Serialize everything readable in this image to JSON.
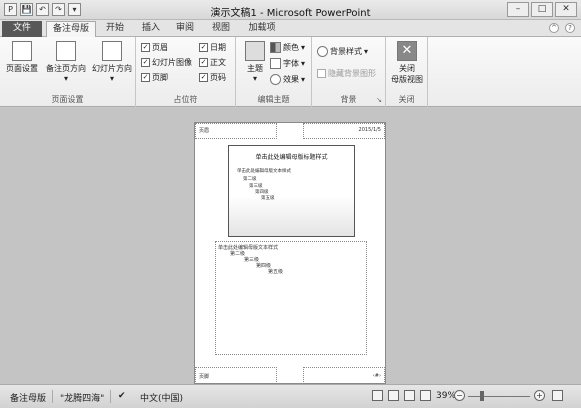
{
  "window": {
    "title": "演示文稿1 - Microsoft PowerPoint",
    "controls": [
      "–",
      "□",
      "✕"
    ]
  },
  "qat": [
    "P",
    "💾",
    "↶",
    "↷",
    "▾"
  ],
  "tabs": [
    {
      "label": "文件",
      "state": "file"
    },
    {
      "label": "备注母版",
      "state": "active"
    },
    {
      "label": "开始",
      "state": ""
    },
    {
      "label": "插入",
      "state": ""
    },
    {
      "label": "审阅",
      "state": ""
    },
    {
      "label": "视图",
      "state": ""
    },
    {
      "label": "加载项",
      "state": ""
    }
  ],
  "ribbon": {
    "page_setup": {
      "label": "页面设置",
      "page_setup_btn": "页面设置",
      "notes_orientation": "备注页方向",
      "slide_orientation": "幻灯片方向"
    },
    "placeholders": {
      "label": "占位符",
      "header": "页眉",
      "slide_image": "幻灯片图像",
      "footer": "页脚",
      "date": "日期",
      "body": "正文",
      "page_number": "页码"
    },
    "edit_theme": {
      "label": "编辑主题",
      "theme": "主题",
      "colors": "颜色",
      "fonts": "字体",
      "effects": "效果"
    },
    "background": {
      "label": "背景",
      "styles": "背景样式",
      "hide_graphics": "隐藏背景图形"
    },
    "close": {
      "label": "关闭",
      "close_btn_line1": "关闭",
      "close_btn_line2": "母版视图"
    }
  },
  "page": {
    "header": "页眉",
    "date": "2015/1/5",
    "slide_title": "单击此处编辑母版标题样式",
    "slide_bullets": [
      "单击此处编辑母版文本样式",
      "第二级",
      "第三级",
      "第四级",
      "第五级"
    ],
    "notes_lines": [
      "单击此处编辑母版文本样式",
      "第二级",
      "第三级",
      "第四级",
      "第五级"
    ],
    "footer": "页脚",
    "page_num": "‹#›"
  },
  "status": {
    "view": "备注母版",
    "theme": "\"龙腾四海\"",
    "language": "中文(中国)",
    "zoom": "39%",
    "zoom_minus": "−",
    "zoom_plus": "+"
  }
}
